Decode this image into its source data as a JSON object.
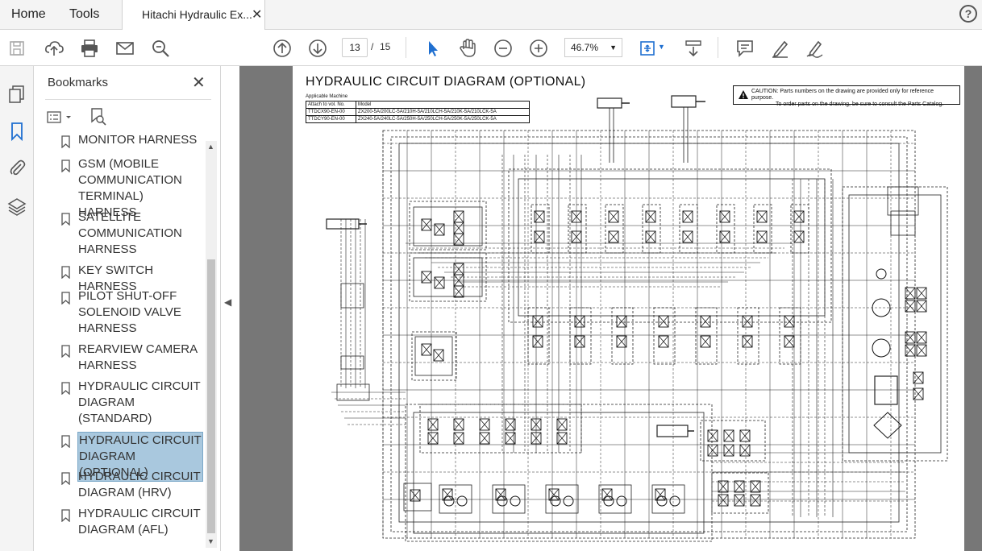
{
  "tabs": {
    "home": "Home",
    "tools": "Tools",
    "document": "Hitachi Hydraulic Ex...",
    "close_glyph": "✕"
  },
  "help_glyph": "?",
  "toolbar": {
    "page_current": "13",
    "page_separator": "/",
    "page_total": "15",
    "zoom": "46.7%"
  },
  "bookmarks": {
    "title": "Bookmarks",
    "close_glyph": "✕",
    "items": [
      {
        "label": "MONITOR HARNESS",
        "selected": false
      },
      {
        "label": "GSM (MOBILE\nCOMMUNICATION\nTERMINAL) HARNESS",
        "selected": false
      },
      {
        "label": "SATELLITE\nCOMMUNICATION\nHARNESS",
        "selected": false
      },
      {
        "label": "KEY SWITCH HARNESS",
        "selected": false
      },
      {
        "label": "PILOT SHUT-OFF\nSOLENOID VALVE\nHARNESS",
        "selected": false
      },
      {
        "label": "REARVIEW CAMERA\nHARNESS",
        "selected": false
      },
      {
        "label": "HYDRAULIC CIRCUIT\nDIAGRAM\n(STANDARD)",
        "selected": false
      },
      {
        "label": "HYDRAULIC CIRCUIT\nDIAGRAM (OPTIONAL)",
        "selected": true
      },
      {
        "label": "HYDRAULIC CIRCUIT\nDIAGRAM (HRV)",
        "selected": false
      },
      {
        "label": "HYDRAULIC CIRCUIT\nDIAGRAM (AFL)",
        "selected": false
      }
    ]
  },
  "document": {
    "title": "HYDRAULIC CIRCUIT DIAGRAM (OPTIONAL)",
    "caution_line1": "CAUTION: Parts numbers on the drawing are provided only for reference purpose.",
    "caution_line2": "To order parts on the drawing, be sure to consult the Parts Catalog.",
    "applicable_title": "Applicable Machine",
    "table_header": [
      "Attach to vol. No.",
      "Model"
    ],
    "table_rows": [
      [
        "TTDCX90-EN-00",
        "ZX200-5A/200LC-5A/210H-5A/210LCH-5A/210K-5A/210LCK-5A"
      ],
      [
        "TTDCY90-EN-00",
        "ZX240-5A/240LC-5A/250H-5A/250LCH-5A/250K-5A/250LCK-5A"
      ]
    ]
  },
  "colors": {
    "selection": "#a9c8de",
    "viewer_bg": "#777777",
    "cursor_blue": "#1f6fd0"
  }
}
